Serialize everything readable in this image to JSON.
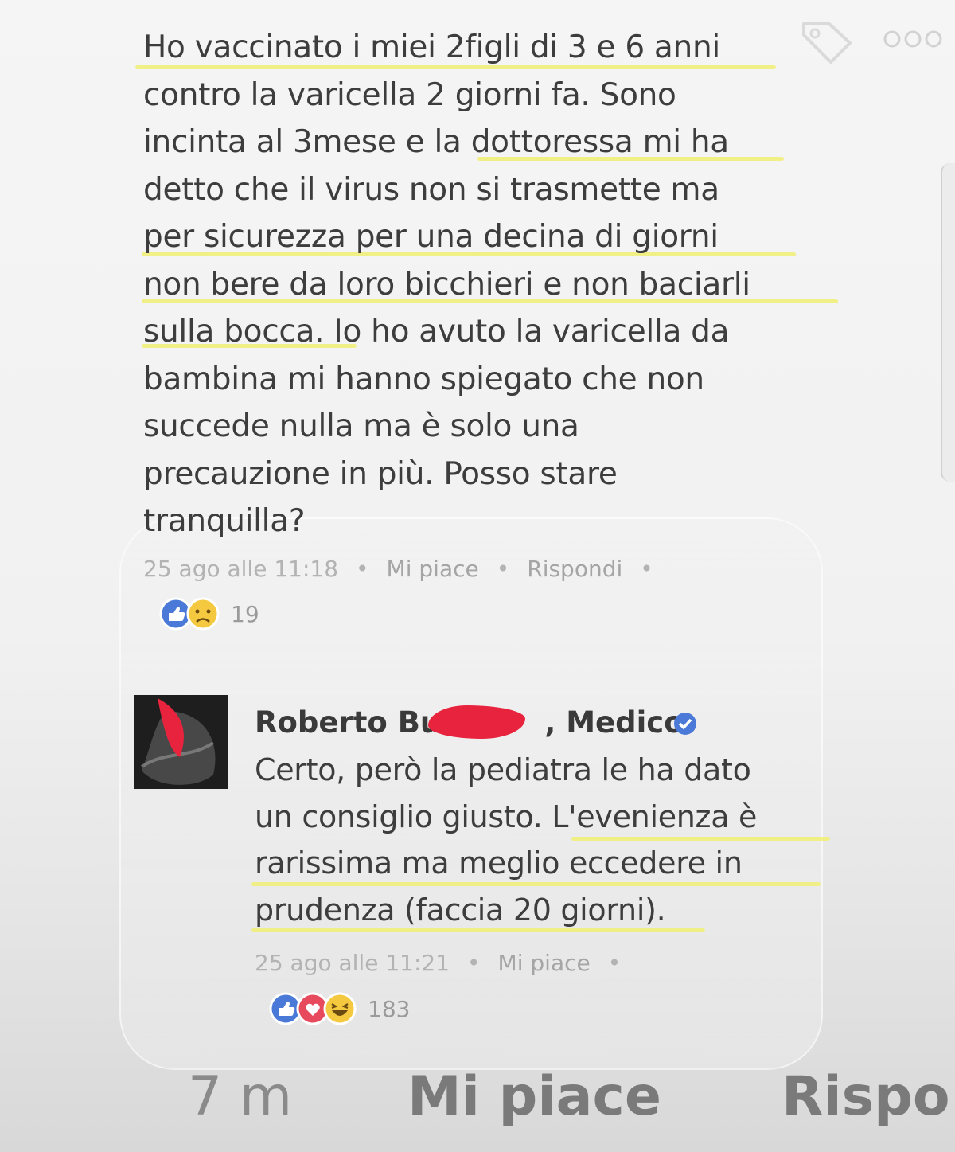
{
  "post": {
    "text": "Ho vaccinato i miei 2figli di 3 e 6 anni\ncontro la varicella 2 giorni fa. Sono\nincinta al 3mese e la dottoressa mi ha\ndetto che il virus non si trasmette ma\nper sicurezza per una decina di giorni\nnon bere da loro bicchieri e non baciarli\nsulla bocca. Io ho avuto la varicella da\nbambina mi hanno spiegato che non\nsuccede nulla ma è solo una\nprecauzione in più. Posso stare\ntranquilla?",
    "timestamp": "25 ago alle 11:18",
    "like_label": "Mi piace",
    "reply_label": "Rispondi",
    "reaction_count": "19"
  },
  "reply": {
    "author_start": "Roberto Bu",
    "author_end": ", Medico",
    "text": "Certo, però la pediatra le ha dato\nun consiglio giusto. L'evenienza è\nrarissima ma meglio eccedere in\nprudenza (faccia 20 giorni).",
    "timestamp": "25 ago alle 11:21",
    "like_label": "Mi piace",
    "reaction_count": "183"
  },
  "bottom_bar": {
    "time": "7 m",
    "like_label": "Mi piace",
    "reply_label": "Rispo"
  },
  "colors": {
    "highlight": "#f1ef7a",
    "like_blue": "#4a79d8",
    "love_red": "#e64a5c",
    "haha_yellow": "#f4c83f",
    "redaction": "#e8233d"
  },
  "icons": [
    "tag-icon",
    "more-icon",
    "like-reaction-icon",
    "sad-reaction-icon",
    "love-reaction-icon",
    "haha-reaction-icon",
    "verified-badge-icon"
  ]
}
